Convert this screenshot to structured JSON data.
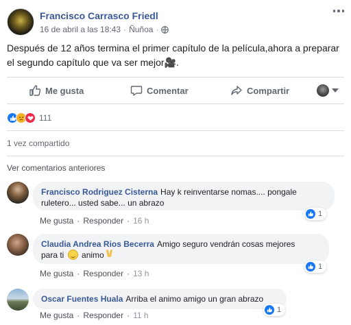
{
  "post": {
    "author": "Francisco Carrasco Friedl",
    "date": "16 de abril a las 18:43",
    "meta_separator": "·",
    "location": "Ñuñoa",
    "text_line1": "Después de 12 años termina el primer capítulo de la película,ahora a preparar",
    "text_line2": "el segundo capítulo que va ser mejor",
    "text_emoji": "🎥",
    "text_end": "."
  },
  "actions": {
    "like_label": "Me gusta",
    "comment_label": "Comentar",
    "share_label": "Compartir"
  },
  "reactions": {
    "count": "111",
    "types": [
      "like",
      "sad",
      "love"
    ]
  },
  "share_count": "1 vez compartido",
  "previous_comments_label": "Ver comentarios anteriores",
  "comments": [
    {
      "author": "Francisco Rodriguez Cisterna",
      "text": "Hay k reinventarse nomas.... pongale ruletero... usted sabe... un abrazo",
      "text_line1": "Hay k reinventarse nomas.... pongale",
      "text_line2": "ruletero... usted sabe... un abrazo",
      "like_label": "Me gusta",
      "reply_label": "Responder",
      "time": "16 h",
      "reaction_count": "1"
    },
    {
      "author": "Claudia Andrea Rios Becerra",
      "text_line1": "Amigo seguro vendrán cosas mejores",
      "text_line2a": "para ti",
      "text_line2b": "animo",
      "like_label": "Me gusta",
      "reply_label": "Responder",
      "time": "13 h",
      "reaction_count": "1"
    },
    {
      "author": "Oscar Fuentes Huala",
      "text": "Arriba el animo amigo un gran abrazo",
      "like_label": "Me gusta",
      "reply_label": "Responder",
      "time": "11 h",
      "reaction_count": "1"
    }
  ],
  "action_separator": "·",
  "colors": {
    "link_blue": "#385898",
    "like_blue": "#1877f2",
    "love_red": "#f0284a",
    "sad_yellow": "#f7b125",
    "bubble_gray": "#f2f3f5"
  },
  "icons": [
    "globe-icon",
    "more-options-icon",
    "thumbs-up-icon",
    "comment-icon",
    "share-icon",
    "chevron-down-icon",
    "smile-emoji-icon",
    "victory-hand-icon",
    "movie-camera-emoji"
  ]
}
